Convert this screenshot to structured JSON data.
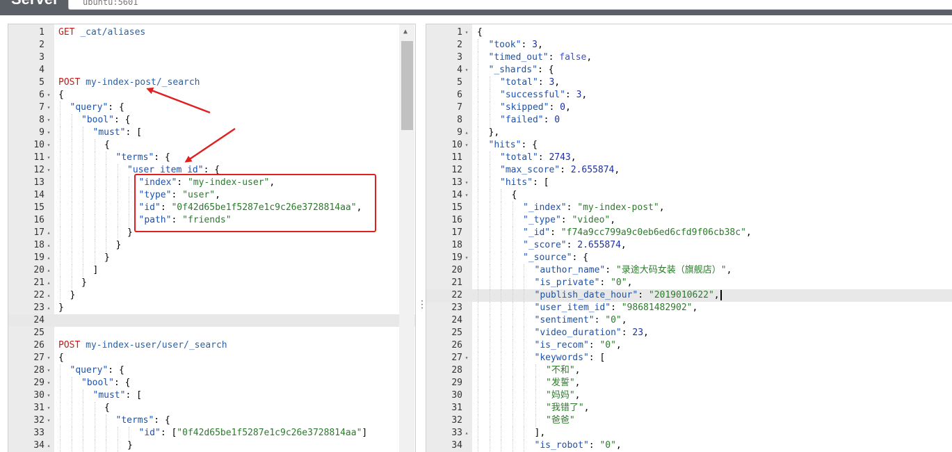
{
  "app": {
    "title": "Server",
    "url_value": "ubuntu:5601"
  },
  "left_editor": {
    "lines": [
      {
        "n": "1",
        "fold": "",
        "indent": 0,
        "parts": [
          [
            "m",
            "GET "
          ],
          [
            "u",
            "_cat/aliases"
          ]
        ]
      },
      {
        "n": "2",
        "fold": "",
        "indent": 0,
        "parts": []
      },
      {
        "n": "3",
        "fold": "",
        "indent": 0,
        "parts": []
      },
      {
        "n": "4",
        "fold": "",
        "indent": 0,
        "parts": []
      },
      {
        "n": "5",
        "fold": "",
        "indent": 0,
        "parts": [
          [
            "m",
            "POST "
          ],
          [
            "u",
            "my-index-post/_search"
          ]
        ]
      },
      {
        "n": "6",
        "fold": "▾",
        "indent": 0,
        "parts": [
          [
            "p",
            "{"
          ]
        ]
      },
      {
        "n": "7",
        "fold": "▾",
        "indent": 1,
        "parts": [
          [
            "k",
            "\"query\""
          ],
          [
            "p",
            ": {"
          ]
        ]
      },
      {
        "n": "8",
        "fold": "▾",
        "indent": 2,
        "parts": [
          [
            "k",
            "\"bool\""
          ],
          [
            "p",
            ": {"
          ]
        ]
      },
      {
        "n": "9",
        "fold": "▾",
        "indent": 3,
        "parts": [
          [
            "k",
            "\"must\""
          ],
          [
            "p",
            ": ["
          ]
        ]
      },
      {
        "n": "10",
        "fold": "▾",
        "indent": 4,
        "parts": [
          [
            "p",
            "{"
          ]
        ]
      },
      {
        "n": "11",
        "fold": "▾",
        "indent": 5,
        "parts": [
          [
            "k",
            "\"terms\""
          ],
          [
            "p",
            ": {"
          ]
        ]
      },
      {
        "n": "12",
        "fold": "▾",
        "indent": 6,
        "parts": [
          [
            "k",
            "\"user_item_id\""
          ],
          [
            "p",
            ": {"
          ]
        ]
      },
      {
        "n": "13",
        "fold": "",
        "indent": 7,
        "parts": [
          [
            "k",
            "\"index\""
          ],
          [
            "p",
            ": "
          ],
          [
            "s",
            "\"my-index-user\""
          ],
          [
            "p",
            ","
          ]
        ]
      },
      {
        "n": "14",
        "fold": "",
        "indent": 7,
        "parts": [
          [
            "k",
            "\"type\""
          ],
          [
            "p",
            ": "
          ],
          [
            "s",
            "\"user\""
          ],
          [
            "p",
            ","
          ]
        ]
      },
      {
        "n": "15",
        "fold": "",
        "indent": 7,
        "parts": [
          [
            "k",
            "\"id\""
          ],
          [
            "p",
            ": "
          ],
          [
            "s",
            "\"0f42d65be1f5287e1c9c26e3728814aa\""
          ],
          [
            "p",
            ","
          ]
        ]
      },
      {
        "n": "16",
        "fold": "",
        "indent": 7,
        "parts": [
          [
            "k",
            "\"path\""
          ],
          [
            "p",
            ": "
          ],
          [
            "s",
            "\"friends\""
          ]
        ]
      },
      {
        "n": "17",
        "fold": "▴",
        "indent": 6,
        "parts": [
          [
            "p",
            "}"
          ]
        ]
      },
      {
        "n": "18",
        "fold": "▴",
        "indent": 5,
        "parts": [
          [
            "p",
            "}"
          ]
        ]
      },
      {
        "n": "19",
        "fold": "▴",
        "indent": 4,
        "parts": [
          [
            "p",
            "}"
          ]
        ]
      },
      {
        "n": "20",
        "fold": "▴",
        "indent": 3,
        "parts": [
          [
            "p",
            "]"
          ]
        ]
      },
      {
        "n": "21",
        "fold": "▴",
        "indent": 2,
        "parts": [
          [
            "p",
            "}"
          ]
        ]
      },
      {
        "n": "22",
        "fold": "▴",
        "indent": 1,
        "parts": [
          [
            "p",
            "}"
          ]
        ]
      },
      {
        "n": "23",
        "fold": "▴",
        "indent": 0,
        "parts": [
          [
            "p",
            "}"
          ]
        ]
      },
      {
        "n": "24",
        "fold": "",
        "indent": 0,
        "parts": [],
        "hl": true
      },
      {
        "n": "25",
        "fold": "",
        "indent": 0,
        "parts": []
      },
      {
        "n": "26",
        "fold": "",
        "indent": 0,
        "parts": [
          [
            "m",
            "POST "
          ],
          [
            "u",
            "my-index-user/user/_search"
          ]
        ]
      },
      {
        "n": "27",
        "fold": "▾",
        "indent": 0,
        "parts": [
          [
            "p",
            "{"
          ]
        ]
      },
      {
        "n": "28",
        "fold": "▾",
        "indent": 1,
        "parts": [
          [
            "k",
            "\"query\""
          ],
          [
            "p",
            ": {"
          ]
        ]
      },
      {
        "n": "29",
        "fold": "▾",
        "indent": 2,
        "parts": [
          [
            "k",
            "\"bool\""
          ],
          [
            "p",
            ": {"
          ]
        ]
      },
      {
        "n": "30",
        "fold": "▾",
        "indent": 3,
        "parts": [
          [
            "k",
            "\"must\""
          ],
          [
            "p",
            ": ["
          ]
        ]
      },
      {
        "n": "31",
        "fold": "▾",
        "indent": 4,
        "parts": [
          [
            "p",
            "{"
          ]
        ]
      },
      {
        "n": "32",
        "fold": "▾",
        "indent": 5,
        "parts": [
          [
            "k",
            "\"terms\""
          ],
          [
            "p",
            ": {"
          ]
        ]
      },
      {
        "n": "33",
        "fold": "",
        "indent": 7,
        "parts": [
          [
            "k",
            "\"id\""
          ],
          [
            "p",
            ": ["
          ],
          [
            "s",
            "\"0f42d65be1f5287e1c9c26e3728814aa\""
          ],
          [
            "p",
            "]"
          ]
        ]
      },
      {
        "n": "34",
        "fold": "▴",
        "indent": 6,
        "parts": [
          [
            "p",
            "}"
          ]
        ]
      }
    ]
  },
  "right_editor": {
    "lines": [
      {
        "n": "1",
        "fold": "▾",
        "indent": 0,
        "parts": [
          [
            "p",
            "{"
          ]
        ]
      },
      {
        "n": "2",
        "fold": "",
        "indent": 1,
        "parts": [
          [
            "k",
            "\"took\""
          ],
          [
            "p",
            ": "
          ],
          [
            "n",
            "3"
          ],
          [
            "p",
            ","
          ]
        ]
      },
      {
        "n": "3",
        "fold": "",
        "indent": 1,
        "parts": [
          [
            "k",
            "\"timed_out\""
          ],
          [
            "p",
            ": "
          ],
          [
            "b",
            "false"
          ],
          [
            "p",
            ","
          ]
        ]
      },
      {
        "n": "4",
        "fold": "▾",
        "indent": 1,
        "parts": [
          [
            "k",
            "\"_shards\""
          ],
          [
            "p",
            ": {"
          ]
        ]
      },
      {
        "n": "5",
        "fold": "",
        "indent": 2,
        "parts": [
          [
            "k",
            "\"total\""
          ],
          [
            "p",
            ": "
          ],
          [
            "n",
            "3"
          ],
          [
            "p",
            ","
          ]
        ]
      },
      {
        "n": "6",
        "fold": "",
        "indent": 2,
        "parts": [
          [
            "k",
            "\"successful\""
          ],
          [
            "p",
            ": "
          ],
          [
            "n",
            "3"
          ],
          [
            "p",
            ","
          ]
        ]
      },
      {
        "n": "7",
        "fold": "",
        "indent": 2,
        "parts": [
          [
            "k",
            "\"skipped\""
          ],
          [
            "p",
            ": "
          ],
          [
            "n",
            "0"
          ],
          [
            "p",
            ","
          ]
        ]
      },
      {
        "n": "8",
        "fold": "",
        "indent": 2,
        "parts": [
          [
            "k",
            "\"failed\""
          ],
          [
            "p",
            ": "
          ],
          [
            "n",
            "0"
          ]
        ]
      },
      {
        "n": "9",
        "fold": "▴",
        "indent": 1,
        "parts": [
          [
            "p",
            "},"
          ]
        ]
      },
      {
        "n": "10",
        "fold": "▾",
        "indent": 1,
        "parts": [
          [
            "k",
            "\"hits\""
          ],
          [
            "p",
            ": {"
          ]
        ]
      },
      {
        "n": "11",
        "fold": "",
        "indent": 2,
        "parts": [
          [
            "k",
            "\"total\""
          ],
          [
            "p",
            ": "
          ],
          [
            "n",
            "2743"
          ],
          [
            "p",
            ","
          ]
        ]
      },
      {
        "n": "12",
        "fold": "",
        "indent": 2,
        "parts": [
          [
            "k",
            "\"max_score\""
          ],
          [
            "p",
            ": "
          ],
          [
            "n",
            "2.655874"
          ],
          [
            "p",
            ","
          ]
        ]
      },
      {
        "n": "13",
        "fold": "▾",
        "indent": 2,
        "parts": [
          [
            "k",
            "\"hits\""
          ],
          [
            "p",
            ": ["
          ]
        ]
      },
      {
        "n": "14",
        "fold": "▾",
        "indent": 3,
        "parts": [
          [
            "p",
            "{"
          ]
        ]
      },
      {
        "n": "15",
        "fold": "",
        "indent": 4,
        "parts": [
          [
            "k",
            "\"_index\""
          ],
          [
            "p",
            ": "
          ],
          [
            "s",
            "\"my-index-post\""
          ],
          [
            "p",
            ","
          ]
        ]
      },
      {
        "n": "16",
        "fold": "",
        "indent": 4,
        "parts": [
          [
            "k",
            "\"_type\""
          ],
          [
            "p",
            ": "
          ],
          [
            "s",
            "\"video\""
          ],
          [
            "p",
            ","
          ]
        ]
      },
      {
        "n": "17",
        "fold": "",
        "indent": 4,
        "parts": [
          [
            "k",
            "\"_id\""
          ],
          [
            "p",
            ": "
          ],
          [
            "s",
            "\"f74a9cc799a9c0eb6ed6cfd9f06cb38c\""
          ],
          [
            "p",
            ","
          ]
        ]
      },
      {
        "n": "18",
        "fold": "",
        "indent": 4,
        "parts": [
          [
            "k",
            "\"_score\""
          ],
          [
            "p",
            ": "
          ],
          [
            "n",
            "2.655874"
          ],
          [
            "p",
            ","
          ]
        ]
      },
      {
        "n": "19",
        "fold": "▾",
        "indent": 4,
        "parts": [
          [
            "k",
            "\"_source\""
          ],
          [
            "p",
            ": {"
          ]
        ]
      },
      {
        "n": "20",
        "fold": "",
        "indent": 5,
        "parts": [
          [
            "k",
            "\"author_name\""
          ],
          [
            "p",
            ": "
          ],
          [
            "s",
            "\"录途大码女装（旗舰店）\""
          ],
          [
            "p",
            ","
          ]
        ]
      },
      {
        "n": "21",
        "fold": "",
        "indent": 5,
        "parts": [
          [
            "k",
            "\"is_private\""
          ],
          [
            "p",
            ": "
          ],
          [
            "s",
            "\"0\""
          ],
          [
            "p",
            ","
          ]
        ]
      },
      {
        "n": "22",
        "fold": "",
        "indent": 5,
        "parts": [
          [
            "k",
            "\"publish_date_hour\""
          ],
          [
            "p",
            ": "
          ],
          [
            "s",
            "\"2019010622\""
          ],
          [
            "p",
            ","
          ]
        ],
        "hl": true,
        "cursor": true
      },
      {
        "n": "23",
        "fold": "",
        "indent": 5,
        "parts": [
          [
            "k",
            "\"user_item_id\""
          ],
          [
            "p",
            ": "
          ],
          [
            "s",
            "\"98681482902\""
          ],
          [
            "p",
            ","
          ]
        ]
      },
      {
        "n": "24",
        "fold": "",
        "indent": 5,
        "parts": [
          [
            "k",
            "\"sentiment\""
          ],
          [
            "p",
            ": "
          ],
          [
            "s",
            "\"0\""
          ],
          [
            "p",
            ","
          ]
        ]
      },
      {
        "n": "25",
        "fold": "",
        "indent": 5,
        "parts": [
          [
            "k",
            "\"video_duration\""
          ],
          [
            "p",
            ": "
          ],
          [
            "n",
            "23"
          ],
          [
            "p",
            ","
          ]
        ]
      },
      {
        "n": "26",
        "fold": "",
        "indent": 5,
        "parts": [
          [
            "k",
            "\"is_recom\""
          ],
          [
            "p",
            ": "
          ],
          [
            "s",
            "\"0\""
          ],
          [
            "p",
            ","
          ]
        ]
      },
      {
        "n": "27",
        "fold": "▾",
        "indent": 5,
        "parts": [
          [
            "k",
            "\"keywords\""
          ],
          [
            "p",
            ": ["
          ]
        ]
      },
      {
        "n": "28",
        "fold": "",
        "indent": 6,
        "parts": [
          [
            "s",
            "\"不和\""
          ],
          [
            "p",
            ","
          ]
        ]
      },
      {
        "n": "29",
        "fold": "",
        "indent": 6,
        "parts": [
          [
            "s",
            "\"发誓\""
          ],
          [
            "p",
            ","
          ]
        ]
      },
      {
        "n": "30",
        "fold": "",
        "indent": 6,
        "parts": [
          [
            "s",
            "\"妈妈\""
          ],
          [
            "p",
            ","
          ]
        ]
      },
      {
        "n": "31",
        "fold": "",
        "indent": 6,
        "parts": [
          [
            "s",
            "\"我错了\""
          ],
          [
            "p",
            ","
          ]
        ]
      },
      {
        "n": "32",
        "fold": "",
        "indent": 6,
        "parts": [
          [
            "s",
            "\"爸爸\""
          ]
        ]
      },
      {
        "n": "33",
        "fold": "▴",
        "indent": 5,
        "parts": [
          [
            "p",
            "],"
          ]
        ]
      },
      {
        "n": "34",
        "fold": "",
        "indent": 5,
        "parts": [
          [
            "k",
            "\"is_robot\""
          ],
          [
            "p",
            ": "
          ],
          [
            "s",
            "\"0\""
          ],
          [
            "p",
            ","
          ]
        ]
      }
    ]
  },
  "divider": {
    "glyph": "⋮"
  },
  "colors": {
    "annotation": "#e02020"
  }
}
